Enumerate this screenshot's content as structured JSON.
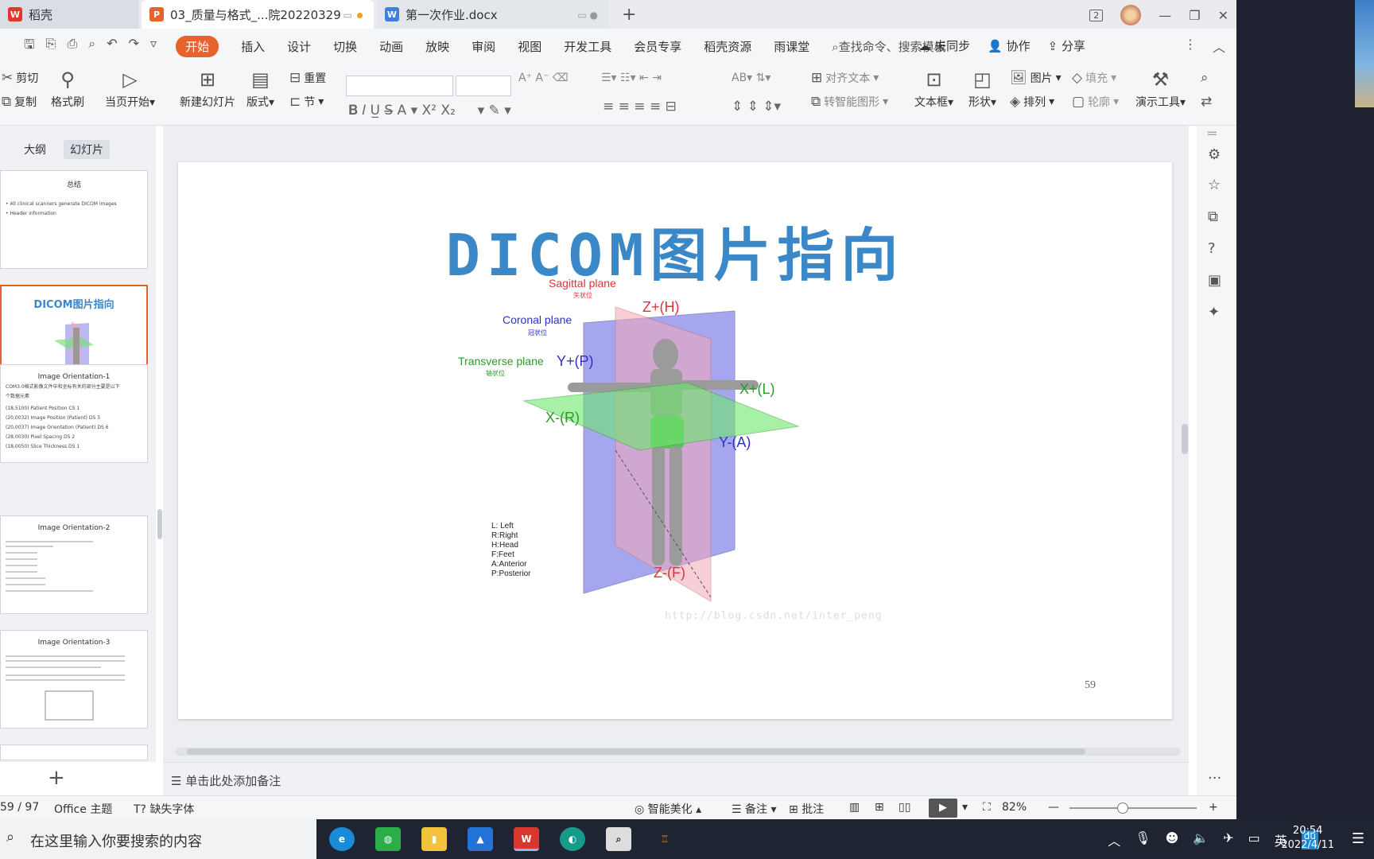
{
  "tabs": [
    {
      "label": "稻壳"
    },
    {
      "label": "03_质量与格式_...院20220329"
    },
    {
      "label": "第一次作业.docx"
    }
  ],
  "window": {
    "badge": "2"
  },
  "menu": {
    "items": [
      "开始",
      "插入",
      "设计",
      "切换",
      "动画",
      "放映",
      "审阅",
      "视图",
      "开发工具",
      "会员专享",
      "稻壳资源",
      "雨课堂"
    ],
    "search_placeholder": "查找命令、搜索模板",
    "right": [
      "未同步",
      "协作",
      "分享"
    ]
  },
  "toolbar": {
    "cut": "剪切",
    "copy": "复制",
    "format_painter": "格式刷",
    "start_from_current": "当页开始",
    "new_slide": "新建幻灯片",
    "layout": "版式",
    "reset": "重置",
    "section": "节",
    "align_text": "对齐文本",
    "smart_art": "转智能图形",
    "textbox": "文本框",
    "shape": "形状",
    "picture": "图片",
    "fill": "填充",
    "arrange": "排列",
    "outline": "轮廓",
    "present_tools": "演示工具"
  },
  "left_panel": {
    "view_tabs": [
      "大纲",
      "幻灯片"
    ],
    "thumbs": [
      {
        "title": "总结",
        "lines": [
          "• All clinical scanners generate DICOM images",
          "• Header information"
        ]
      },
      {
        "title": "DICOM图片指向",
        "lines": []
      },
      {
        "title": "Image Orientation-1",
        "lines": [
          "COM3.0格式影像文件中和坐标有关的部分主要是以下",
          "个数据元素",
          "(18,5100) Patient Position          CS 1",
          "(20,0032) Image Position (Patient)    DS 3",
          "(20,0037) Image Orientation (Patient) DS 6",
          "(28,0030) Pixel Spacing               DS 2",
          "(18,0050) Slice Thickness             DS 1"
        ]
      },
      {
        "title": "Image Orientation-2",
        "lines": []
      },
      {
        "title": "Image Orientation-3",
        "lines": []
      }
    ]
  },
  "slide": {
    "title": "DICOM图片指向",
    "planes": {
      "sagittal": {
        "label": "Sagittal plane",
        "sub": "矢状位",
        "color": "#e0323c"
      },
      "coronal": {
        "label": "Coronal plane",
        "sub": "冠状位",
        "color": "#2f2fc8"
      },
      "transverse": {
        "label": "Transverse plane",
        "sub": "轴状位",
        "color": "#2a9a2a"
      }
    },
    "axes": [
      "Z+(H)",
      "Y+(P)",
      "X+(L)",
      "X-(R)",
      "Y-(A)",
      "Z-(F)"
    ],
    "legend": [
      "L: Left",
      "R:Right",
      "H:Head",
      "F:Feet",
      "A:Anterior",
      "P:Posterior"
    ],
    "watermark": "http://blog.csdn.net/inter_peng",
    "number": "59"
  },
  "notes_placeholder": "单击此处添加备注",
  "status": {
    "page": "59 / 97",
    "theme": "Office 主题",
    "missing_font": "缺失字体",
    "beautify": "智能美化",
    "notes": "备注",
    "comment": "批注",
    "zoom": "82%"
  },
  "taskbar": {
    "search_placeholder": "在这里输入你要搜索的内容",
    "lang": "英",
    "time": "20:54",
    "date": "2022/4/11"
  }
}
